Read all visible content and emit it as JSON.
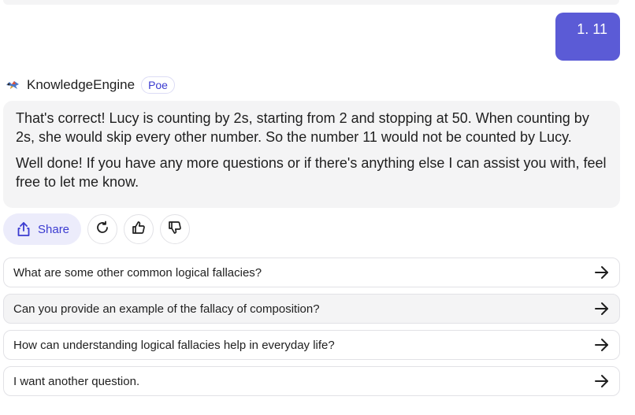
{
  "user_message": {
    "text": "1. 11"
  },
  "bot": {
    "name": "KnowledgeEngine",
    "badge": "Poe",
    "avatar_icon": "colorful-bird-icon",
    "paragraphs": [
      "That's correct! Lucy is counting by 2s, starting from 2 and stopping at 50. When counting by 2s, she would skip every other number. So the number 11 would not be counted by Lucy.",
      "Well done! If you have any more questions or if there's anything else I can assist you with, feel free to let me know."
    ]
  },
  "actions": {
    "share_label": "Share",
    "icons": [
      "share-icon",
      "retry-icon",
      "thumbs-up-icon",
      "thumbs-down-icon"
    ]
  },
  "suggestions": [
    "What are some other common logical fallacies?",
    "Can you provide an example of the fallacy of composition?",
    "How can understanding logical fallacies help in everyday life?",
    "I want another question."
  ],
  "colors": {
    "accent": "#5b5bd6",
    "accent_text": "#3b3bd0",
    "bubble_bg": "#f4f4f5"
  }
}
